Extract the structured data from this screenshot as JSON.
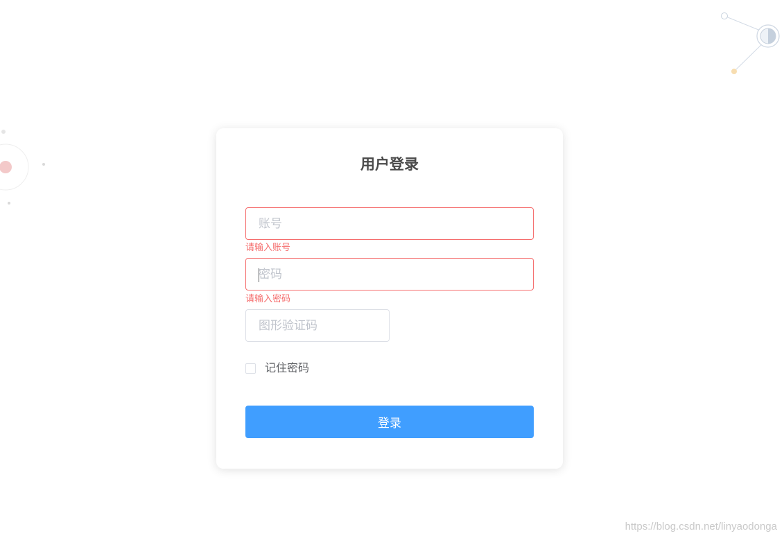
{
  "login": {
    "title": "用户登录",
    "account_placeholder": "账号",
    "account_error": "请输入账号",
    "password_placeholder": "密码",
    "password_error": "请输入密码",
    "captcha_placeholder": "图形验证码",
    "remember_label": "记住密码",
    "submit_label": "登录"
  },
  "watermark": "https://blog.csdn.net/linyaodonga",
  "colors": {
    "primary": "#409eff",
    "error": "#f56c6c",
    "text": "#606266",
    "placeholder": "#c0c4cc"
  }
}
